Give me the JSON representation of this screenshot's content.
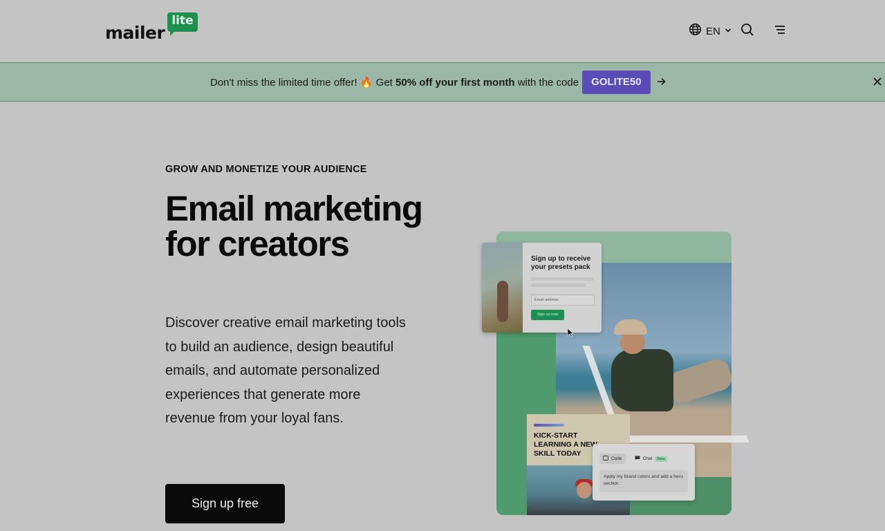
{
  "header": {
    "logo_word": "mailer",
    "logo_badge": "lite",
    "language": "EN"
  },
  "promo": {
    "text_before": "Don't miss the limited time offer! 🔥 Get ",
    "text_bold": "50% off your first month",
    "text_after": " with the code",
    "code": "GOLITE50"
  },
  "hero": {
    "eyebrow": "GROW AND MONETIZE YOUR AUDIENCE",
    "title": "Email marketing for creators",
    "subtitle": "Discover creative email marketing tools to build an audience, design beautiful emails, and automate personalized experiences that generate more revenue from your loyal fans.",
    "cta_label": "Sign up free"
  },
  "visual": {
    "signup_card": {
      "title": "Sign up to receive your presets pack",
      "email_placeholder": "Email address",
      "button_label": "Sign up now"
    },
    "kick_card": {
      "title": "KICK-START LEARNING A NEW SKILL TODAY"
    },
    "chat_card": {
      "tab_code": "Code",
      "tab_chat": "Chat",
      "beta": "Beta",
      "message": "Apply my brand colors and add a hero section."
    }
  },
  "icons": {
    "globe": "globe-icon",
    "chevron": "chevron-down-icon",
    "search": "search-icon",
    "menu": "menu-icon",
    "arrow": "arrow-right-icon",
    "close": "close-icon"
  },
  "colors": {
    "promo_bg": "#9bb7a7",
    "code_bg": "#5b4bb6",
    "brand_green": "#1f8f4e",
    "cta_bg": "#0a0a0a"
  }
}
